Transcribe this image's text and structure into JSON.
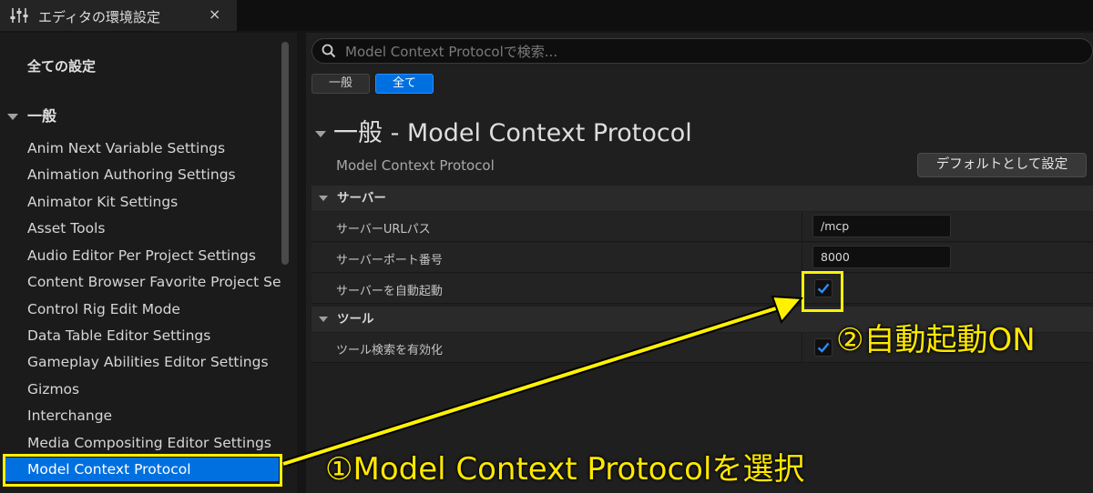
{
  "window": {
    "tab_title": "エディタの環境設定",
    "close_glyph": "×",
    "icon": "sliders-icon"
  },
  "sidebar": {
    "all_settings": "全ての設定",
    "category": "一般",
    "items": [
      {
        "label": "Anim Next Variable Settings"
      },
      {
        "label": "Animation Authoring Settings"
      },
      {
        "label": "Animator Kit Settings"
      },
      {
        "label": "Asset Tools"
      },
      {
        "label": "Audio Editor Per Project Settings"
      },
      {
        "label": "Content Browser Favorite Project Se"
      },
      {
        "label": "Control Rig Edit Mode"
      },
      {
        "label": "Data Table Editor Settings"
      },
      {
        "label": "Gameplay Abilities Editor Settings"
      },
      {
        "label": "Gizmos"
      },
      {
        "label": "Interchange"
      },
      {
        "label": "Media Compositing Editor Settings"
      },
      {
        "label": "Model Context Protocol",
        "selected": true
      }
    ]
  },
  "search": {
    "placeholder": "Model Context Protocolで検索..."
  },
  "filters": {
    "general": "一般",
    "all": "全て"
  },
  "section": {
    "title": "一般 - Model Context Protocol",
    "subtitle": "Model Context Protocol",
    "default_button": "デフォルトとして設定"
  },
  "groups": {
    "server": {
      "label": "サーバー",
      "rows": {
        "url_path": {
          "label": "サーバーURLパス",
          "value": "/mcp"
        },
        "port": {
          "label": "サーバーポート番号",
          "value": "8000"
        },
        "autostart": {
          "label": "サーバーを自動起動",
          "checked": true
        }
      }
    },
    "tools": {
      "label": "ツール",
      "rows": {
        "enable_search": {
          "label": "ツール検索を有効化",
          "checked": true
        }
      }
    }
  },
  "annotations": {
    "step1": "①Model Context Protocolを選択",
    "step2": "②自動起動ON",
    "color": "#ffe800"
  },
  "colors": {
    "accent": "#0070e0",
    "annotation": "#fff200"
  }
}
